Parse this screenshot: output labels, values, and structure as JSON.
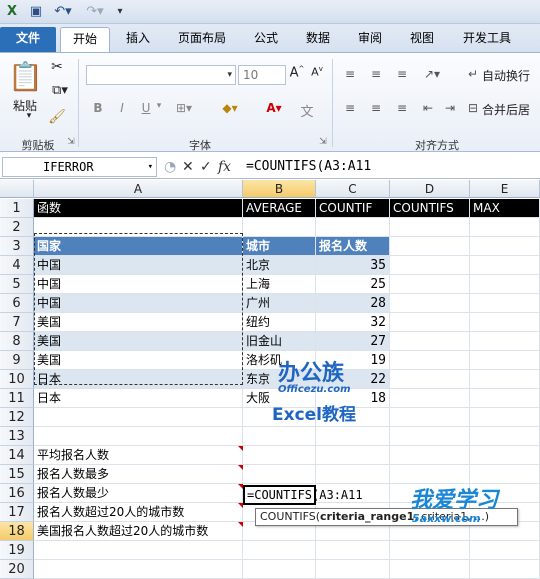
{
  "window": {
    "quick_access_icons": [
      "save-icon",
      "undo-icon",
      "redo-icon",
      "customize-icon"
    ]
  },
  "tabs": [
    {
      "label": "文件"
    },
    {
      "label": "开始"
    },
    {
      "label": "插入"
    },
    {
      "label": "页面布局"
    },
    {
      "label": "公式"
    },
    {
      "label": "数据"
    },
    {
      "label": "审阅"
    },
    {
      "label": "视图"
    },
    {
      "label": "开发工具"
    }
  ],
  "ribbon": {
    "clipboard": {
      "paste": "粘贴",
      "group": "剪贴板"
    },
    "font": {
      "size": "10",
      "group": "字体",
      "bold": "B",
      "italic": "I",
      "underline": "U"
    },
    "align": {
      "group": "对齐方式",
      "wrap": "自动换行",
      "merge": "合并后居"
    }
  },
  "formula_bar": {
    "name_box": "IFERROR",
    "fx": "fx",
    "formula": "=COUNTIFS(A3:A11"
  },
  "columns": [
    "A",
    "B",
    "C",
    "D",
    "E"
  ],
  "rows": [
    "1",
    "2",
    "3",
    "4",
    "5",
    "6",
    "7",
    "8",
    "9",
    "10",
    "11",
    "12",
    "13",
    "14",
    "15",
    "16",
    "17",
    "18",
    "19",
    "20"
  ],
  "row1": {
    "a": "函数",
    "b": "AVERAGE",
    "c": "COUNTIF",
    "d": "COUNTIFS",
    "e": "MAX"
  },
  "table": {
    "header": {
      "country": "国家",
      "city": "城市",
      "count": "报名人数"
    },
    "rows": [
      {
        "country": "中国",
        "city": "北京",
        "count": "35"
      },
      {
        "country": "中国",
        "city": "上海",
        "count": "25"
      },
      {
        "country": "中国",
        "city": "广州",
        "count": "28"
      },
      {
        "country": "美国",
        "city": "纽约",
        "count": "32"
      },
      {
        "country": "美国",
        "city": "旧金山",
        "count": "27"
      },
      {
        "country": "美国",
        "city": "洛杉矶",
        "count": "19"
      },
      {
        "country": "日本",
        "city": "东京",
        "count": "22"
      },
      {
        "country": "日本",
        "city": "大阪",
        "count": "18"
      }
    ]
  },
  "questions": [
    "平均报名人数",
    "报名人数最多",
    "报名人数最少",
    "报名人数超过20人的城市数",
    "美国报名人数超过20人的城市数"
  ],
  "active_cell": {
    "text": "=COUNTIFS(A3:A11"
  },
  "tooltip": {
    "func": "COUNTIFS(",
    "arg1": "criteria_range1",
    "rest": ", criteria1, ...)"
  },
  "watermarks": {
    "logo1": "办公族",
    "logo1_sub": "Officezu.com",
    "logo2": "Excel教程",
    "logo3": "我爱学习",
    "logo3_sub": "5axxw.com"
  },
  "colors": {
    "header_black": "#000000",
    "table_header": "#4f81bd",
    "band": "#dce6f1",
    "file_tab": "#2a6fb8"
  }
}
